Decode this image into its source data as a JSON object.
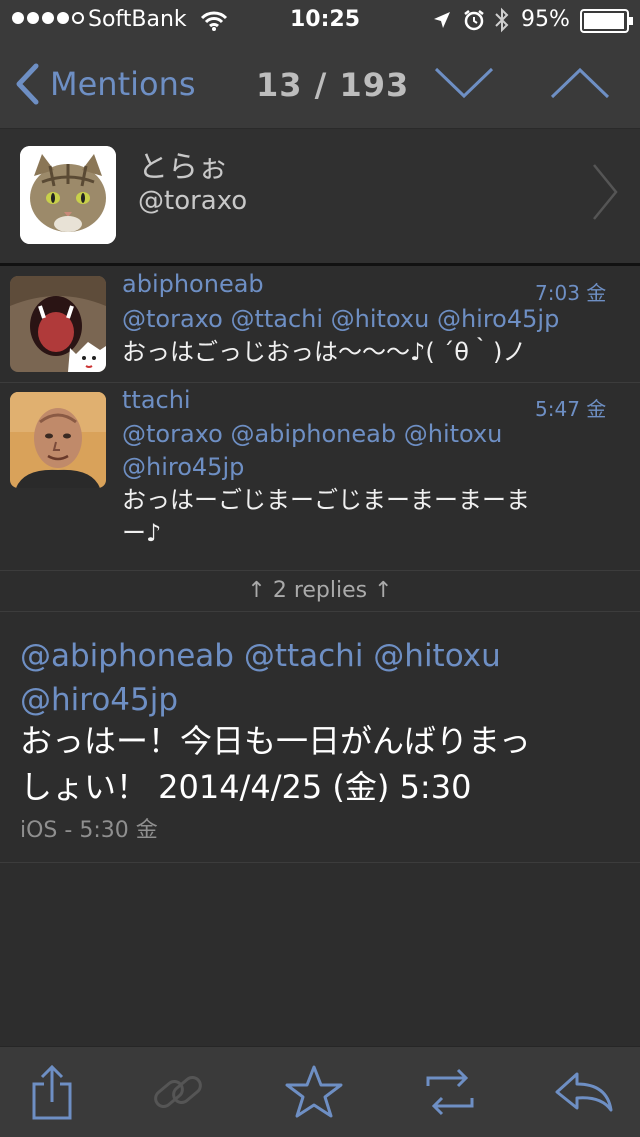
{
  "status_bar": {
    "carrier": "SoftBank",
    "time": "10:25",
    "battery": "95%",
    "icons": [
      "signal-dots",
      "wifi-icon",
      "location-arrow-icon",
      "alarm-icon",
      "bluetooth-icon",
      "battery-icon"
    ]
  },
  "nav": {
    "back_label": "Mentions",
    "counter": "13 / 193",
    "icons": [
      "chevron-left-icon",
      "chevron-down-icon",
      "chevron-up-icon"
    ]
  },
  "profile": {
    "display_name": "とらぉ",
    "handle": "@toraxo"
  },
  "tweets": [
    {
      "user": "abiphoneab",
      "time": "7:03 金",
      "mentions": "@toraxo @ttachi @hitoxu @hiro45jp",
      "text": "おっはごっじおっは〜〜〜♪( ´θ｀)ノ"
    },
    {
      "user": "ttachi",
      "time": "5:47 金",
      "mentions_line1": "@toraxo @abiphoneab @hitoxu",
      "mentions_line2": "@hiro45jp",
      "text_line1": "おっはーごじまーごじまーまーまーま",
      "text_line2": "ー♪"
    }
  ],
  "replies_label": "↑ 2 replies ↑",
  "main_tweet": {
    "mentions_line1": "@abiphoneab @ttachi @hitoxu",
    "mentions_line2": "@hiro45jp",
    "text_line1": "おっはー！今日も一日がんばりまっ",
    "text_line2": "しょい！ 2014/4/25 (金) 5:30",
    "meta": "iOS - 5:30 金"
  },
  "toolbar": {
    "icons": [
      "share-icon",
      "link-icon",
      "star-icon",
      "retweet-icon",
      "reply-icon"
    ]
  },
  "colors": {
    "accent": "#6e8fc4",
    "background": "#2d2d2d",
    "bar": "#3a3a3a"
  }
}
